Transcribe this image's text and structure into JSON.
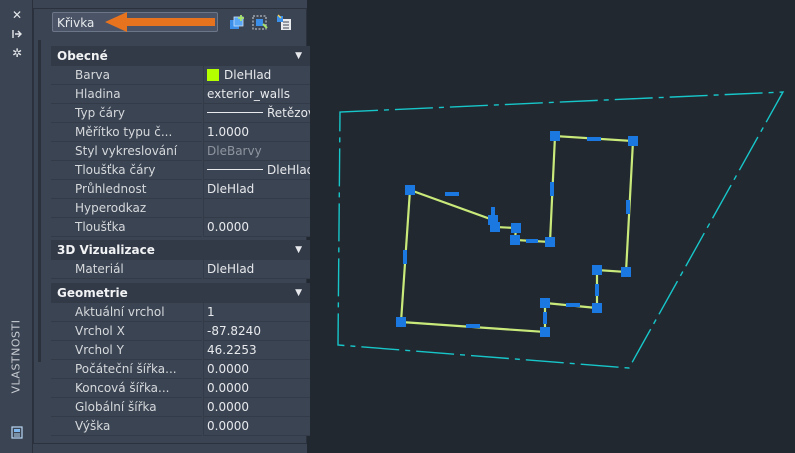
{
  "strip": {
    "title": "VLASTNOSTI",
    "icons": [
      "close-icon",
      "pin-icon",
      "settings-icon",
      "properties-icon"
    ]
  },
  "toolbar": {
    "object_type": "Křivka",
    "icons": [
      "add-to-selection-icon",
      "quick-select-icon",
      "toggle-pickadd-icon"
    ]
  },
  "sections": [
    {
      "title": "Obecné",
      "rows": [
        {
          "label": "Barva",
          "value": "DleHlad"
        },
        {
          "label": "Hladina",
          "value": "exterior_walls"
        },
        {
          "label": "Typ čáry",
          "value": "Řetězová"
        },
        {
          "label": "Měřítko typu č...",
          "value": "1.0000"
        },
        {
          "label": "Styl vykreslování",
          "value": "DleBarvy"
        },
        {
          "label": "Tloušťka čáry",
          "value": "DleHlad"
        },
        {
          "label": "Průhlednost",
          "value": "DleHlad"
        },
        {
          "label": "Hyperodkaz",
          "value": ""
        },
        {
          "label": "Tloušťka",
          "value": "0.0000"
        }
      ]
    },
    {
      "title": "3D Vizualizace",
      "rows": [
        {
          "label": "Materiál",
          "value": "DleHlad"
        }
      ]
    },
    {
      "title": "Geometrie",
      "rows": [
        {
          "label": "Aktuální vrchol",
          "value": "1"
        },
        {
          "label": "Vrchol X",
          "value": "-87.8240"
        },
        {
          "label": "Vrchol Y",
          "value": "46.2253"
        },
        {
          "label": "Počáteční šířka...",
          "value": "0.0000"
        },
        {
          "label": "Koncová šířka...",
          "value": "0.0000"
        },
        {
          "label": "Globální šířka",
          "value": "0.0000"
        },
        {
          "label": "Výška",
          "value": "0.0000"
        }
      ]
    }
  ],
  "colors": {
    "palette_bg": "#3b4453",
    "canvas_bg": "#212830",
    "color_swatch": "#b3ff00",
    "arrow": "#e8731e",
    "boundary_line": "#17c6c9",
    "polyline": "#c9ea7a",
    "grip": "#1a78e0"
  }
}
